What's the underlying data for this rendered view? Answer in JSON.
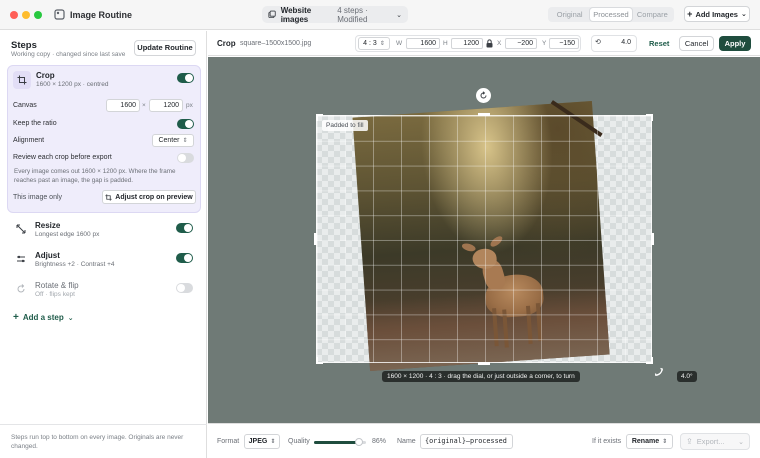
{
  "window": {
    "title": "Image Routine",
    "document_name": "Website images",
    "document_meta": "4 steps · Modified",
    "view_modes": [
      "Original",
      "Processed",
      "Compare"
    ],
    "active_view": "Processed",
    "add_images_label": "Add Images"
  },
  "sidebar": {
    "title": "Steps",
    "subtitle": "Working copy · changed since last save",
    "update_button": "Update Routine",
    "crop": {
      "name": "Crop",
      "desc": "1600 × 1200 px · centred",
      "enabled": true,
      "canvas_label": "Canvas",
      "canvas_w": "1600",
      "times": "×",
      "canvas_h": "1200",
      "unit": "px",
      "keep_ratio_label": "Keep the ratio",
      "keep_ratio": true,
      "alignment_label": "Alignment",
      "alignment_value": "Center",
      "review_label": "Review each crop before export",
      "review": false,
      "help": "Every image comes out 1600 × 1200 px. Where the frame reaches past an image, the gap is padded.",
      "this_image_label": "This image only",
      "adjust_button": "Adjust crop on preview"
    },
    "steps": [
      {
        "name": "Resize",
        "desc": "Longest edge 1600 px",
        "enabled": true
      },
      {
        "name": "Adjust",
        "desc": "Brightness +2 · Contrast +4",
        "enabled": true
      },
      {
        "name": "Rotate & flip",
        "desc": "Off · flips kept",
        "enabled": false
      }
    ],
    "add_step": "Add a step",
    "footer": "Steps run top to bottom on every image. Originals are never changed."
  },
  "toolbar": {
    "mode": "Crop",
    "file": "square–1500x1500.jpg",
    "ratio": "4 : 3",
    "w_label": "W",
    "w": "1600",
    "h_label": "H",
    "h": "1200",
    "x_label": "X",
    "x": "−200",
    "y_label": "Y",
    "y": "−150",
    "angle": "4.0",
    "reset": "Reset",
    "cancel": "Cancel",
    "apply": "Apply"
  },
  "canvas": {
    "padded_label": "Padded to fill",
    "hint": "1600 × 1200 · 4 : 3 · drag the dial, or just outside a corner, to turn",
    "angle_badge": "4.0°"
  },
  "bottombar": {
    "format_label": "Format",
    "format": "JPEG",
    "quality_label": "Quality",
    "quality_value": "86%",
    "quality": 0.86,
    "name_label": "Name",
    "name_value": "{original}–processed",
    "if_exists_label": "If it exists",
    "if_exists": "Rename",
    "export": "Export..."
  },
  "colors": {
    "accent": "#1f4d3e",
    "card": "#efedfb",
    "canvas_bg": "#6f7a76"
  }
}
